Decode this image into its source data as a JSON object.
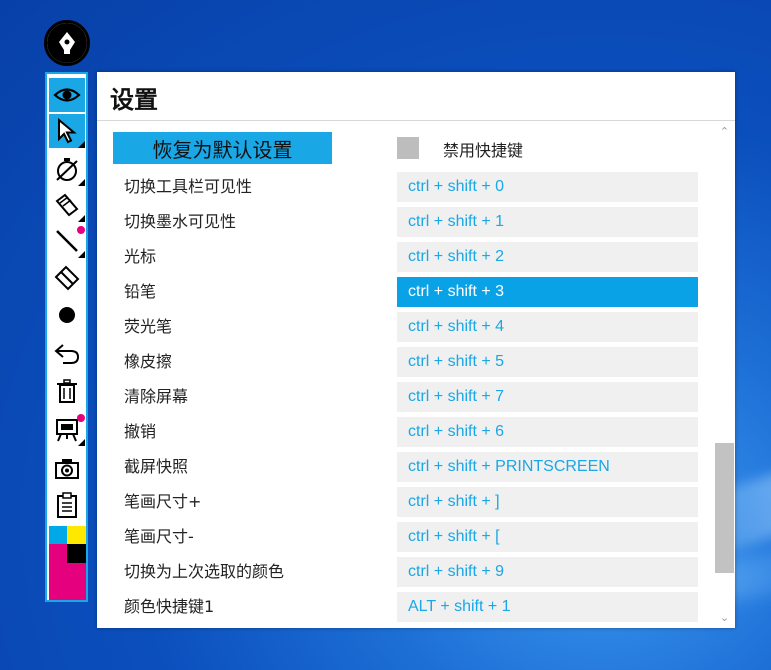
{
  "dialog": {
    "title": "设置",
    "reset_button": "恢复为默认设置",
    "disable_shortcuts_label": "禁用快捷键"
  },
  "shortcuts": [
    {
      "label": "切换工具栏可见性",
      "keys": "ctrl + shift + 0"
    },
    {
      "label": "切换墨水可见性",
      "keys": "ctrl + shift + 1"
    },
    {
      "label": "光标",
      "keys": "ctrl + shift + 2"
    },
    {
      "label": "铅笔",
      "keys": "ctrl + shift + 3",
      "selected": true
    },
    {
      "label": "荧光笔",
      "keys": "ctrl + shift + 4"
    },
    {
      "label": "橡皮擦",
      "keys": "ctrl + shift + 5"
    },
    {
      "label": "清除屏幕",
      "keys": "ctrl + shift + 7"
    },
    {
      "label": "撤销",
      "keys": "ctrl + shift + 6"
    },
    {
      "label": "截屏快照",
      "keys": "ctrl + shift + PRINTSCREEN"
    },
    {
      "label": "笔画尺寸+",
      "keys": "ctrl + shift + ]"
    },
    {
      "label": "笔画尺寸-",
      "keys": "ctrl + shift + ["
    },
    {
      "label": "切换为上次选取的颜色",
      "keys": "ctrl + shift + 9"
    },
    {
      "label": "颜色快捷键1",
      "keys": "ALT + shift + 1"
    }
  ],
  "toolbar": {
    "tools": [
      {
        "icon": "eye-icon",
        "active": true
      },
      {
        "icon": "cursor-arrow-icon",
        "active": true
      },
      {
        "icon": "stopwatch-off-icon"
      },
      {
        "icon": "highlighter-icon"
      },
      {
        "icon": "pencil-line-icon"
      },
      {
        "icon": "eraser-icon"
      },
      {
        "icon": "filled-circle-icon"
      },
      {
        "icon": "undo-icon"
      },
      {
        "icon": "trash-icon"
      },
      {
        "icon": "easel-icon"
      },
      {
        "icon": "camera-icon"
      },
      {
        "icon": "clipboard-icon"
      }
    ],
    "palette_colors": [
      "#00a8e8",
      "#ffe800",
      "#e5007e",
      "#000000",
      "#e5007e"
    ],
    "accent": "#19a7e6",
    "badge_color": "#e5007e"
  }
}
